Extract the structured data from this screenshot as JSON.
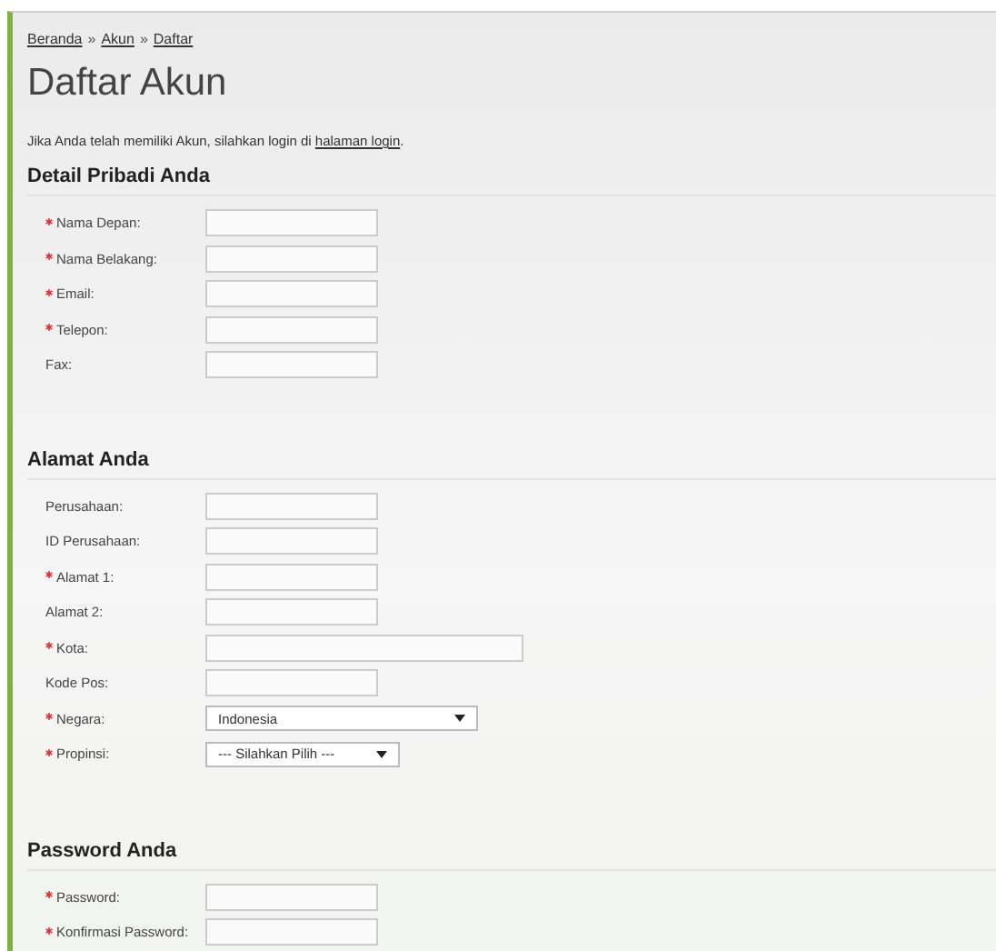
{
  "breadcrumb": [
    "Beranda",
    "Akun",
    "Daftar"
  ],
  "breadcrumb_separator": "»",
  "title": "Daftar Akun",
  "intro": {
    "text": "Jika Anda telah memiliki Akun, silahkan login di",
    "link": "halaman login",
    "end": "."
  },
  "sections": [
    {
      "heading": "Detail Pribadi Anda",
      "fields": [
        {
          "label": "Nama Depan:",
          "required": true,
          "kind": "text",
          "wide": false
        },
        {
          "label": "Nama Belakang:",
          "required": true,
          "kind": "text",
          "wide": false
        },
        {
          "label": "Email:",
          "required": true,
          "kind": "text",
          "wide": false
        },
        {
          "label": "Telepon:",
          "required": true,
          "kind": "text",
          "wide": false
        },
        {
          "label": "Fax:",
          "required": false,
          "kind": "text",
          "wide": false
        }
      ]
    },
    {
      "heading": "Alamat Anda",
      "fields": [
        {
          "label": "Perusahaan:",
          "required": false,
          "kind": "text",
          "wide": false
        },
        {
          "label": "ID Perusahaan:",
          "required": false,
          "kind": "text",
          "wide": false
        },
        {
          "label": "Alamat 1:",
          "required": true,
          "kind": "text",
          "wide": false
        },
        {
          "label": "Alamat 2:",
          "required": false,
          "kind": "text",
          "wide": false
        },
        {
          "label": "Kota:",
          "required": true,
          "kind": "text",
          "wide": true
        },
        {
          "label": "Kode Pos:",
          "required": false,
          "kind": "text",
          "wide": false
        },
        {
          "label": "Negara:",
          "required": true,
          "kind": "select",
          "wide": true,
          "value": "Indonesia"
        },
        {
          "label": "Propinsi:",
          "required": true,
          "kind": "select",
          "wide": false,
          "value": "--- Silahkan Pilih ---"
        }
      ]
    },
    {
      "heading": "Password Anda",
      "fields": [
        {
          "label": "Password:",
          "required": true,
          "kind": "text",
          "wide": false
        },
        {
          "label": "Konfirmasi Password:",
          "required": true,
          "kind": "text",
          "wide": false
        }
      ]
    }
  ]
}
